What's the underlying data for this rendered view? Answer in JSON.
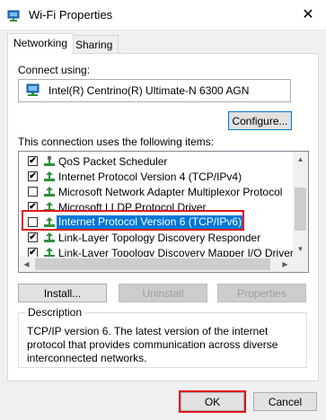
{
  "window": {
    "title": "Wi-Fi Properties",
    "close_glyph": "✕"
  },
  "tabs": [
    {
      "label": "Networking"
    },
    {
      "label": "Sharing"
    }
  ],
  "connect_using_label": "Connect using:",
  "adapter_name": "Intel(R) Centrino(R) Ultimate-N 6300 AGN",
  "configure_label": "Configure...",
  "items_label": "This connection uses the following items:",
  "items": [
    {
      "label": "QoS Packet Scheduler",
      "checked": true,
      "check": "✔"
    },
    {
      "label": "Internet Protocol Version 4 (TCP/IPv4)",
      "checked": true,
      "check": "✔"
    },
    {
      "label": "Microsoft Network Adapter Multiplexor Protocol",
      "checked": false,
      "check": ""
    },
    {
      "label": "Microsoft LLDP Protocol Driver",
      "checked": true,
      "check": "✔"
    },
    {
      "label": "Internet Protocol Version 6 (TCP/IPv6)",
      "checked": false,
      "check": "",
      "selected": true
    },
    {
      "label": "Link-Layer Topology Discovery Responder",
      "checked": true,
      "check": "✔"
    },
    {
      "label": "Link-Layer Topology Discovery Mapper I/O Driver",
      "checked": true,
      "check": "✔"
    }
  ],
  "buttons": {
    "install": "Install...",
    "uninstall": "Uninstall",
    "properties": "Properties",
    "ok": "OK",
    "cancel": "Cancel"
  },
  "description": {
    "legend": "Description",
    "text": "TCP/IP version 6. The latest version of the internet protocol that provides communication across diverse interconnected networks."
  },
  "colors": {
    "selection": "#0078d7",
    "highlight": "#e0141e",
    "accent": "#0078d7"
  }
}
